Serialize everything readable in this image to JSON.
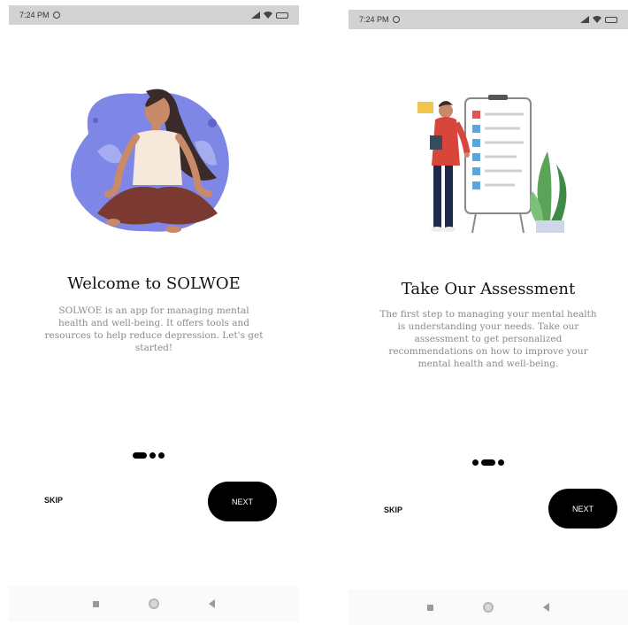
{
  "status_bar": {
    "time": "7:24 PM"
  },
  "screens": [
    {
      "title": "Welcome to SOLWOE",
      "description": "SOLWOE is an app for managing mental health and well-being. It offers tools and resources to help reduce depression. Let's get started!",
      "active_page": 1,
      "page_count": 3,
      "skip_label": "SKIP",
      "next_label": "NEXT",
      "illustration": "meditating-woman-illustration"
    },
    {
      "title": "Take Our Assessment",
      "description": "The first step to managing your mental health is understanding your needs. Take our assessment to get personalized recommendations on how to improve your mental health and well-being.",
      "active_page": 2,
      "page_count": 3,
      "skip_label": "SKIP",
      "next_label": "NEXT",
      "illustration": "man-with-checklist-board-illustration"
    }
  ],
  "colors": {
    "accent": "#000000",
    "blob": "#7e86e6",
    "skin": "#c98a6a"
  }
}
